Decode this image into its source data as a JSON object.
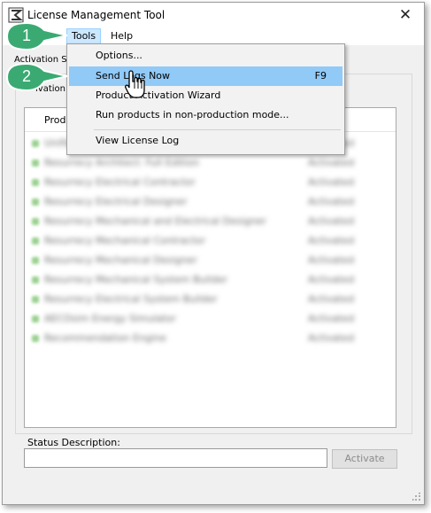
{
  "window": {
    "title": "License Management Tool",
    "close_glyph": "✕"
  },
  "menubar": {
    "tools": "Tools",
    "help": "Help"
  },
  "tabs": {
    "activation_status": "Activation St",
    "activation_partial": "ivation"
  },
  "list": {
    "column_product": "Produ",
    "rows": [
      {
        "name": "Unified Product Name",
        "status": "Activated"
      },
      {
        "name": "Resurrecy Architect: Full Edition",
        "status": "Activated"
      },
      {
        "name": "Resurrecy Electrical Contractor",
        "status": "Activated"
      },
      {
        "name": "Resurrecy Electrical Designer",
        "status": "Activated"
      },
      {
        "name": "Resurrecy Mechanical and Electrical Designer",
        "status": "Activated"
      },
      {
        "name": "Resurrecy Mechanical Contractor",
        "status": "Activated"
      },
      {
        "name": "Resurrecy Mechanical Designer",
        "status": "Activated"
      },
      {
        "name": "Resurrecy Mechanical System Builder",
        "status": "Activated"
      },
      {
        "name": "Resurrecy Electrical System Builder",
        "status": "Activated"
      },
      {
        "name": "AECOsim Energy Simulator",
        "status": "Activated"
      },
      {
        "name": "Recommendation Engine",
        "status": "Activated"
      }
    ]
  },
  "status": {
    "label": "Status Description:",
    "activate_button": "Activate"
  },
  "tools_menu": {
    "items": [
      {
        "label": "Options...",
        "shortcut": ""
      },
      {
        "label": "Send Logs Now",
        "shortcut": "F9"
      },
      {
        "label": "Product Activation Wizard",
        "shortcut": ""
      },
      {
        "label": "Run products in non-production mode...",
        "shortcut": ""
      },
      {
        "label": "View License Log",
        "shortcut": ""
      }
    ]
  },
  "callouts": {
    "one": "1",
    "two": "2",
    "color": "#3aaa72"
  }
}
